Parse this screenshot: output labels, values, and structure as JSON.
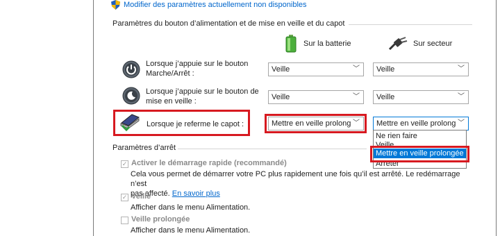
{
  "top_link": {
    "label": "Modifier des paramètres actuellement non disponibles",
    "icon": "shield-icon"
  },
  "section_buttons": {
    "title": "Paramètres du bouton d’alimentation et de mise en veille et du capot"
  },
  "columns": {
    "battery": "Sur la batterie",
    "ac": "Sur secteur"
  },
  "rows": [
    {
      "label_line1": "Lorsque j’appuie sur le bouton",
      "label_line2": "Marche/Arrêt :",
      "battery_value": "Veille",
      "ac_value": "Veille"
    },
    {
      "label_line1": "Lorsque j’appuie sur le bouton de",
      "label_line2": "mise en veille :",
      "battery_value": "Veille",
      "ac_value": "Veille"
    },
    {
      "label": "Lorsque je referme le capot :",
      "battery_value": "Mettre en veille prolong",
      "ac_value": "Mettre en veille prolong"
    }
  ],
  "dropdown_options": [
    "Ne rien faire",
    "Veille",
    "Mettre en veille prolongée",
    "Arrêter"
  ],
  "dropdown_selected": "Mettre en veille prolongée",
  "section_shutdown": {
    "title": "Paramètres d’arrêt"
  },
  "shutdown": {
    "fast_startup": {
      "label": "Activer le démarrage rapide (recommandé)",
      "checked": true,
      "desc_line1": "Cela vous permet de démarrer votre PC plus rapidement une fois qu’il est arrêté. Le redémarrage n’est",
      "desc_line2_prefix": "pas affecté.",
      "learn_more": "En savoir plus"
    },
    "sleep": {
      "label": "Veille",
      "checked": true,
      "desc": "Afficher dans le menu Alimentation."
    },
    "hibernate": {
      "label": "Veille prolongée",
      "checked": false,
      "desc": "Afficher dans le menu Alimentation."
    }
  },
  "colors": {
    "highlight": "#d71920",
    "link": "#0066cc",
    "selection": "#0078d7"
  }
}
